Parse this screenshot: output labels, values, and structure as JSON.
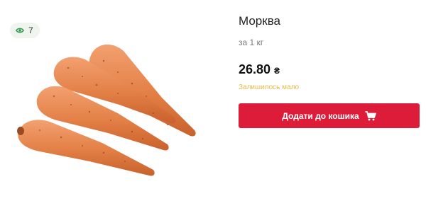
{
  "badge": {
    "icon": "eye-icon",
    "views": "7",
    "color": "#2e9a4a"
  },
  "product": {
    "image": "carrots-photo",
    "title": "Морква",
    "unit": "за 1 кг",
    "price": "26.80",
    "currency": "₴",
    "stock_status": "Залишилось мало",
    "stock_color": "#e8b84a"
  },
  "cart_button": {
    "label": "Додати до кошика",
    "icon": "cart-icon",
    "color": "#dd1c3a"
  }
}
